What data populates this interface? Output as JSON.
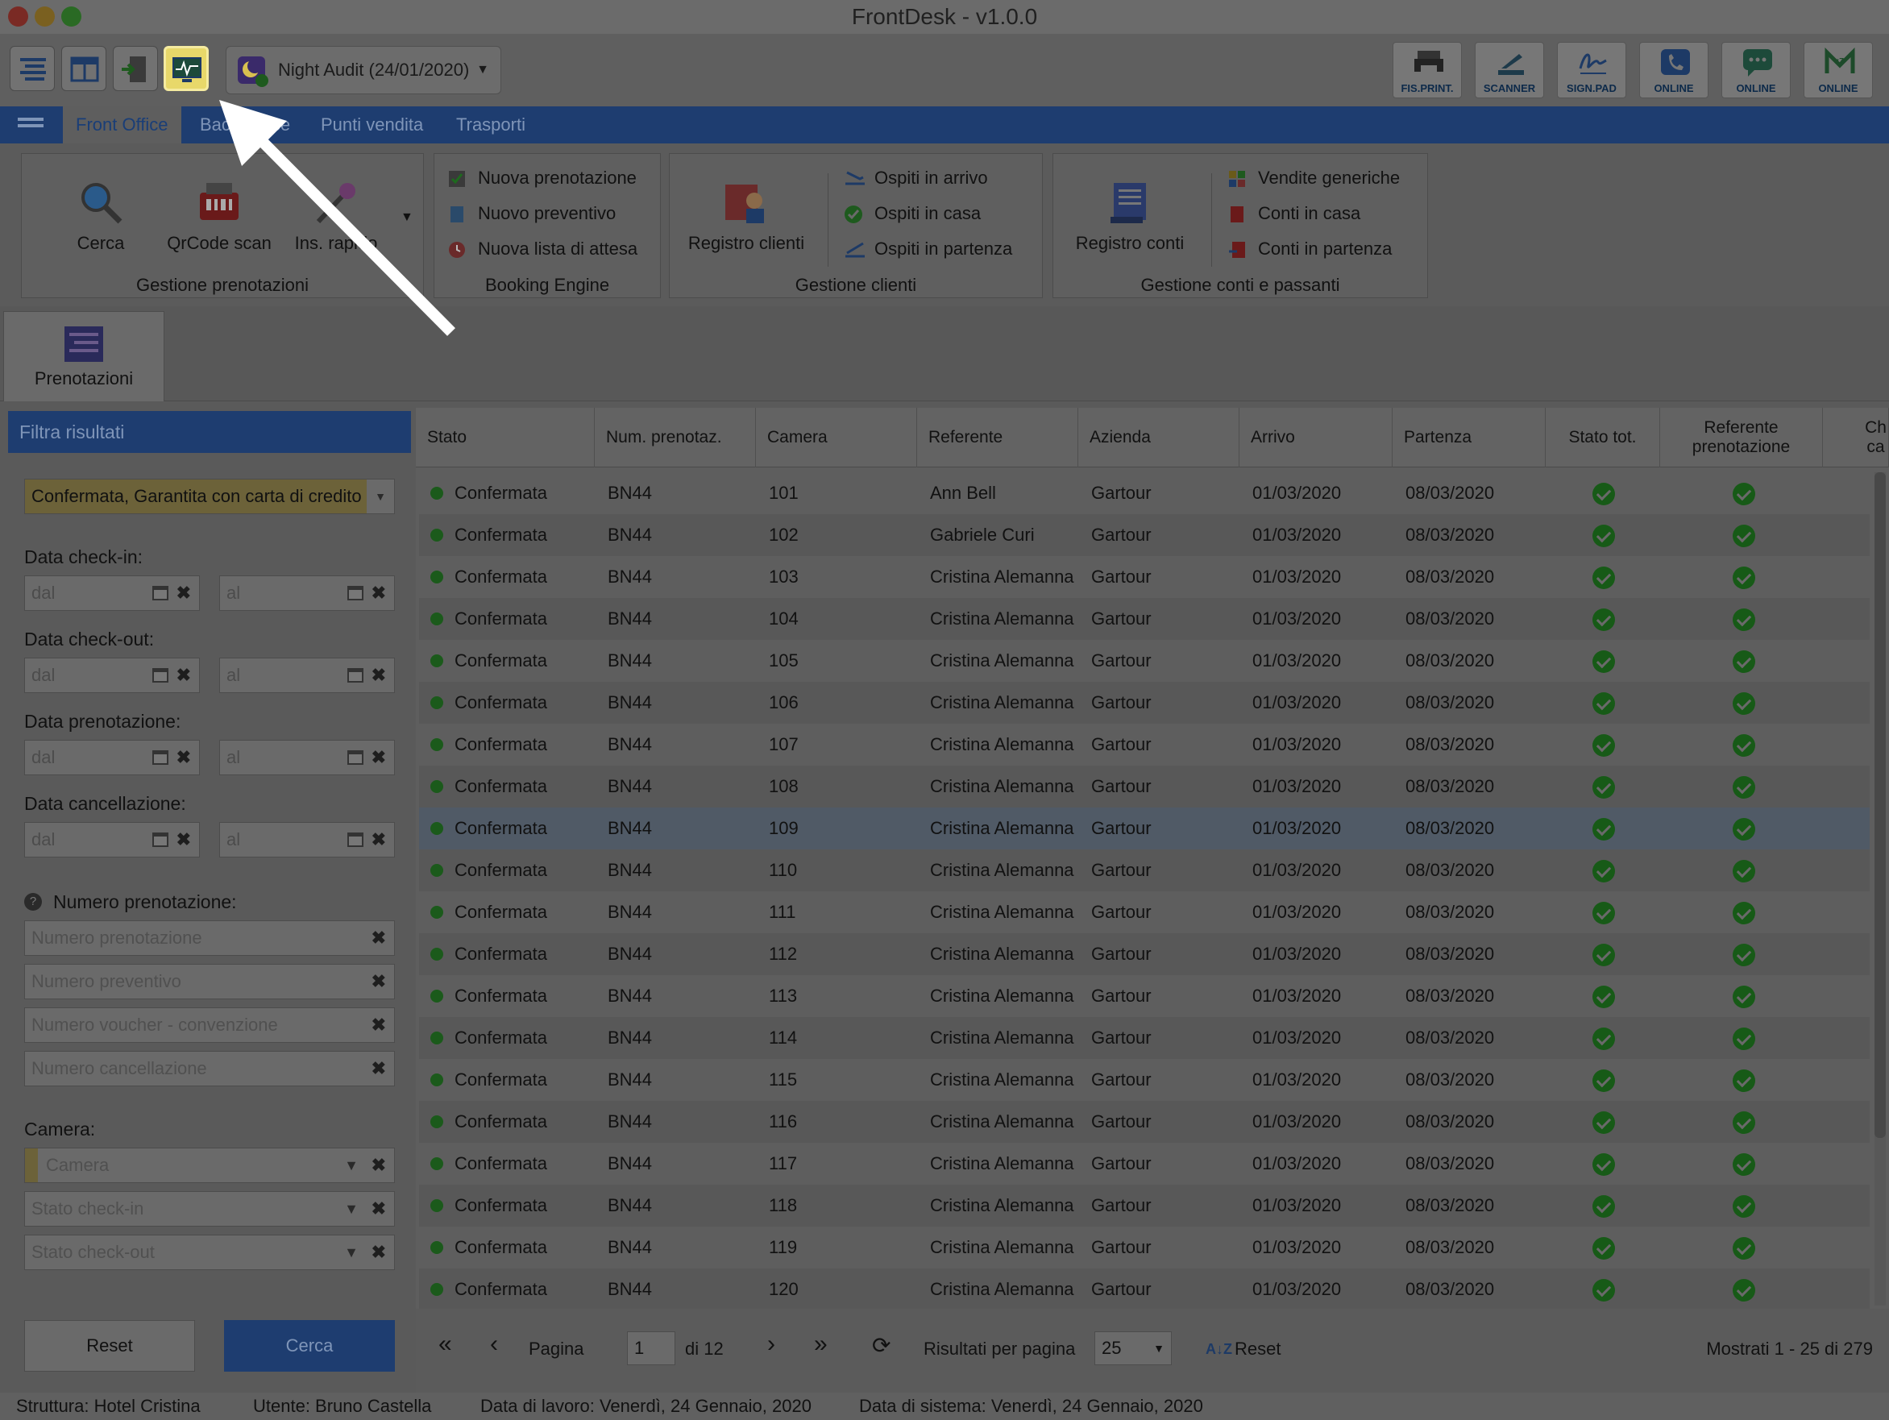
{
  "app_title": "FrontDesk - v1.0.0",
  "toolbar": {
    "night_audit": "Night Audit (24/01/2020)",
    "right_buttons": [
      "FIS.PRINT.",
      "SCANNER",
      "SIGN.PAD",
      "ONLINE",
      "ONLINE",
      "ONLINE"
    ]
  },
  "tabs": [
    "Front Office",
    "Back Office",
    "Punti vendita",
    "Trasporti"
  ],
  "ribbon": {
    "gestione_prenotazioni": {
      "title": "Gestione prenotazioni",
      "cerca": "Cerca",
      "qrcode": "QrCode scan",
      "ins_rapido": "Ins. rapido"
    },
    "booking_engine": {
      "title": "Booking Engine",
      "items": [
        "Nuova prenotazione",
        "Nuovo preventivo",
        "Nuova lista di attesa"
      ]
    },
    "gestione_clienti": {
      "title": "Gestione clienti",
      "registro": "Registro clienti",
      "items": [
        "Ospiti in arrivo",
        "Ospiti in casa",
        "Ospiti in partenza"
      ]
    },
    "gestione_conti": {
      "title": "Gestione conti e passanti",
      "registro": "Registro conti",
      "items": [
        "Vendite generiche",
        "Conti in casa",
        "Conti in partenza"
      ]
    }
  },
  "doc_tab": "Prenotazioni",
  "filter": {
    "header": "Filtra risultati",
    "stato_value": "Confermata, Garantita con carta di credito",
    "checkin_label": "Data check-in:",
    "checkout_label": "Data check-out:",
    "prenotazione_label": "Data prenotazione:",
    "cancellazione_label": "Data cancellazione:",
    "dal": "dal",
    "al": "al",
    "numero_label": "Numero prenotazione:",
    "ph_numero": "Numero prenotazione",
    "ph_preventivo": "Numero preventivo",
    "ph_voucher": "Numero voucher - convenzione",
    "ph_cancellazione": "Numero cancellazione",
    "camera_label": "Camera:",
    "ph_camera": "Camera",
    "ph_stato_checkin": "Stato check-in",
    "ph_stato_checkout": "Stato check-out",
    "reset": "Reset",
    "cerca": "Cerca"
  },
  "table": {
    "headers": [
      "Stato",
      "Num. prenotaz.",
      "Camera",
      "Referente",
      "Azienda",
      "Arrivo",
      "Partenza",
      "Stato tot.",
      "Referente prenotazione",
      "Ch ca"
    ],
    "rows": [
      {
        "stato": "Confermata",
        "num": "BN44",
        "camera": "101",
        "referente": "Ann Bell",
        "azienda": "Gartour",
        "arrivo": "01/03/2020",
        "partenza": "08/03/2020"
      },
      {
        "stato": "Confermata",
        "num": "BN44",
        "camera": "102",
        "referente": "Gabriele Curi",
        "azienda": "Gartour",
        "arrivo": "01/03/2020",
        "partenza": "08/03/2020"
      },
      {
        "stato": "Confermata",
        "num": "BN44",
        "camera": "103",
        "referente": "Cristina Alemanna",
        "azienda": "Gartour",
        "arrivo": "01/03/2020",
        "partenza": "08/03/2020"
      },
      {
        "stato": "Confermata",
        "num": "BN44",
        "camera": "104",
        "referente": "Cristina Alemanna",
        "azienda": "Gartour",
        "arrivo": "01/03/2020",
        "partenza": "08/03/2020"
      },
      {
        "stato": "Confermata",
        "num": "BN44",
        "camera": "105",
        "referente": "Cristina Alemanna",
        "azienda": "Gartour",
        "arrivo": "01/03/2020",
        "partenza": "08/03/2020"
      },
      {
        "stato": "Confermata",
        "num": "BN44",
        "camera": "106",
        "referente": "Cristina Alemanna",
        "azienda": "Gartour",
        "arrivo": "01/03/2020",
        "partenza": "08/03/2020"
      },
      {
        "stato": "Confermata",
        "num": "BN44",
        "camera": "107",
        "referente": "Cristina Alemanna",
        "azienda": "Gartour",
        "arrivo": "01/03/2020",
        "partenza": "08/03/2020"
      },
      {
        "stato": "Confermata",
        "num": "BN44",
        "camera": "108",
        "referente": "Cristina Alemanna",
        "azienda": "Gartour",
        "arrivo": "01/03/2020",
        "partenza": "08/03/2020"
      },
      {
        "stato": "Confermata",
        "num": "BN44",
        "camera": "109",
        "referente": "Cristina Alemanna",
        "azienda": "Gartour",
        "arrivo": "01/03/2020",
        "partenza": "08/03/2020"
      },
      {
        "stato": "Confermata",
        "num": "BN44",
        "camera": "110",
        "referente": "Cristina Alemanna",
        "azienda": "Gartour",
        "arrivo": "01/03/2020",
        "partenza": "08/03/2020"
      },
      {
        "stato": "Confermata",
        "num": "BN44",
        "camera": "111",
        "referente": "Cristina Alemanna",
        "azienda": "Gartour",
        "arrivo": "01/03/2020",
        "partenza": "08/03/2020"
      },
      {
        "stato": "Confermata",
        "num": "BN44",
        "camera": "112",
        "referente": "Cristina Alemanna",
        "azienda": "Gartour",
        "arrivo": "01/03/2020",
        "partenza": "08/03/2020"
      },
      {
        "stato": "Confermata",
        "num": "BN44",
        "camera": "113",
        "referente": "Cristina Alemanna",
        "azienda": "Gartour",
        "arrivo": "01/03/2020",
        "partenza": "08/03/2020"
      },
      {
        "stato": "Confermata",
        "num": "BN44",
        "camera": "114",
        "referente": "Cristina Alemanna",
        "azienda": "Gartour",
        "arrivo": "01/03/2020",
        "partenza": "08/03/2020"
      },
      {
        "stato": "Confermata",
        "num": "BN44",
        "camera": "115",
        "referente": "Cristina Alemanna",
        "azienda": "Gartour",
        "arrivo": "01/03/2020",
        "partenza": "08/03/2020"
      },
      {
        "stato": "Confermata",
        "num": "BN44",
        "camera": "116",
        "referente": "Cristina Alemanna",
        "azienda": "Gartour",
        "arrivo": "01/03/2020",
        "partenza": "08/03/2020"
      },
      {
        "stato": "Confermata",
        "num": "BN44",
        "camera": "117",
        "referente": "Cristina Alemanna",
        "azienda": "Gartour",
        "arrivo": "01/03/2020",
        "partenza": "08/03/2020"
      },
      {
        "stato": "Confermata",
        "num": "BN44",
        "camera": "118",
        "referente": "Cristina Alemanna",
        "azienda": "Gartour",
        "arrivo": "01/03/2020",
        "partenza": "08/03/2020"
      },
      {
        "stato": "Confermata",
        "num": "BN44",
        "camera": "119",
        "referente": "Cristina Alemanna",
        "azienda": "Gartour",
        "arrivo": "01/03/2020",
        "partenza": "08/03/2020"
      },
      {
        "stato": "Confermata",
        "num": "BN44",
        "camera": "120",
        "referente": "Cristina Alemanna",
        "azienda": "Gartour",
        "arrivo": "01/03/2020",
        "partenza": "08/03/2020"
      }
    ]
  },
  "pager": {
    "pagina": "Pagina",
    "page_value": "1",
    "di": "di 12",
    "risultati": "Risultati per pagina",
    "per_page": "25",
    "reset": "Reset",
    "mostrati": "Mostrati 1 - 25 di 279"
  },
  "status": {
    "struttura": "Struttura: Hotel Cristina",
    "utente": "Utente: Bruno Castella",
    "data_lavoro": "Data di lavoro: Venerdì, 24 Gennaio, 2020",
    "data_sistema": "Data di sistema: Venerdì, 24 Gennaio, 2020"
  }
}
